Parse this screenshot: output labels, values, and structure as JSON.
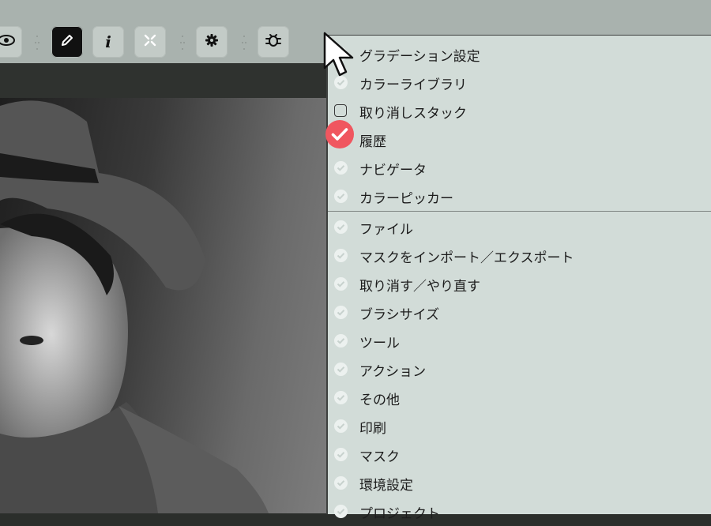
{
  "toolbar": {
    "buttons": [
      {
        "name": "eye-icon",
        "active": false
      },
      {
        "name": "pen-icon",
        "active": true
      },
      {
        "name": "info-icon",
        "active": false,
        "glyph": "i"
      },
      {
        "name": "fullscreen-icon",
        "active": false
      },
      {
        "name": "gear-icon",
        "active": false
      },
      {
        "name": "bug-icon",
        "active": false
      }
    ]
  },
  "menu": {
    "items": [
      {
        "label": "グラデーション設定",
        "state": "checked"
      },
      {
        "label": "カラーライブラリ",
        "state": "checked"
      },
      {
        "label": "取り消しスタック",
        "state": "unchecked"
      },
      {
        "label": "履歴",
        "state": "highlighted"
      },
      {
        "label": "ナビゲータ",
        "state": "checked"
      },
      {
        "label": "カラーピッカー",
        "state": "checked"
      },
      {
        "label": "ファイル",
        "state": "checked"
      },
      {
        "label": "マスクをインポート／エクスポート",
        "state": "checked"
      },
      {
        "label": "取り消す／やり直す",
        "state": "checked"
      },
      {
        "label": "ブラシサイズ",
        "state": "checked"
      },
      {
        "label": "ツール",
        "state": "checked"
      },
      {
        "label": "アクション",
        "state": "checked"
      },
      {
        "label": "その他",
        "state": "checked"
      },
      {
        "label": "印刷",
        "state": "checked"
      },
      {
        "label": "マスク",
        "state": "checked"
      },
      {
        "label": "環境設定",
        "state": "checked"
      },
      {
        "label": "プロジェクト",
        "state": "checked"
      }
    ]
  },
  "colors": {
    "toolbar_bg": "#a9b2ae",
    "menu_bg": "#d2dcd8",
    "highlight_red": "#f0565f"
  }
}
